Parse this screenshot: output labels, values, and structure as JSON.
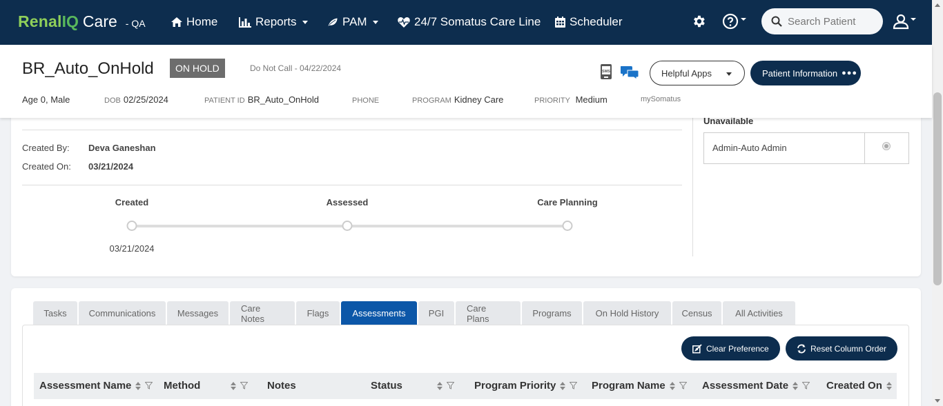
{
  "brand": {
    "renal": "Renal",
    "iq": "IQ",
    "care": "Care",
    "env": "- QA"
  },
  "nav": {
    "home": "Home",
    "reports": "Reports",
    "pam": "PAM",
    "careline": "24/7 Somatus Care Line",
    "scheduler": "Scheduler"
  },
  "search": {
    "placeholder": "Search Patient"
  },
  "patient": {
    "name": "BR_Auto_OnHold",
    "status": "ON HOLD",
    "do_not_call": "Do Not Call - 04/22/2024",
    "age_sex": "Age 0, Male",
    "dob_label": "DOB",
    "dob": "02/25/2024",
    "pid_label": "PATIENT ID",
    "pid": "BR_Auto_OnHold",
    "phone_label": "PHONE",
    "program_label": "PROGRAM",
    "program": "Kidney Care",
    "priority_label": "PRIORITY",
    "priority": "Medium",
    "mysomatus": "mySomatus"
  },
  "header_buttons": {
    "helpful_apps": "Helpful Apps",
    "patient_info": "Patient Information"
  },
  "details": {
    "created_by_label": "Created By:",
    "created_by": "Deva Ganeshan",
    "created_on_label": "Created On:",
    "created_on": "03/21/2024",
    "unavailable": "Unavailable",
    "assignee": "Admin-Auto Admin"
  },
  "steps": [
    {
      "label": "Created",
      "date": "03/21/2024"
    },
    {
      "label": "Assessed",
      "date": ""
    },
    {
      "label": "Care Planning",
      "date": ""
    }
  ],
  "tabs": [
    "Tasks",
    "Communications",
    "Messages",
    "Care Notes",
    "Flags",
    "Assessments",
    "PGI",
    "Care Plans",
    "Programs",
    "On Hold History",
    "Census",
    "All Activities"
  ],
  "table_buttons": {
    "clear": "Clear Preference",
    "reset": "Reset Column Order"
  },
  "columns": [
    "Assessment Name",
    "Method",
    "Notes",
    "Status",
    "Program Priority",
    "Program Name",
    "Assessment Date",
    "Created On"
  ],
  "colors": {
    "navy": "#0d2d4e",
    "active_tab": "#0c57a8",
    "logo_green": "#8fcf5a"
  }
}
